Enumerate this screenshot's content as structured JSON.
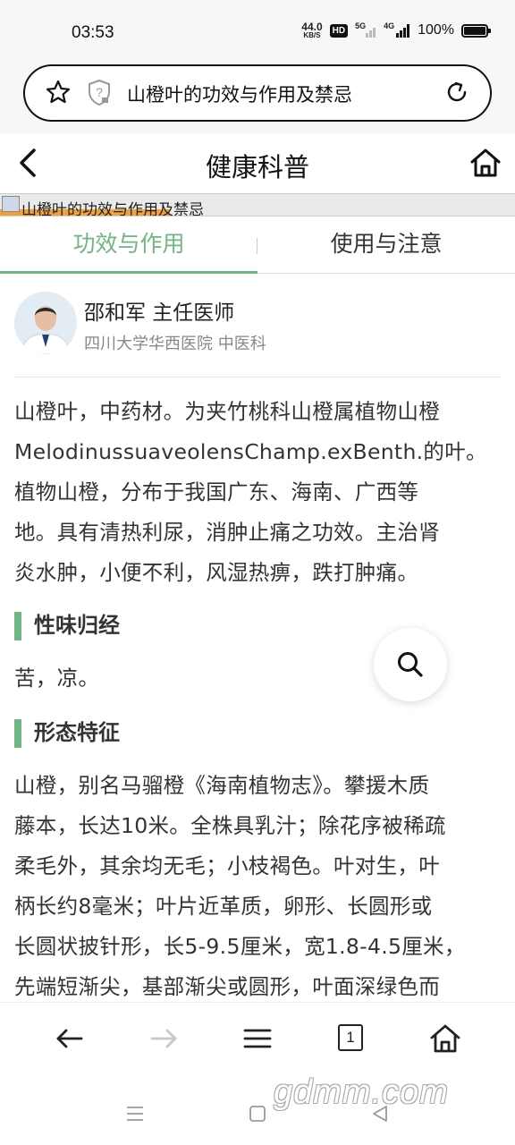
{
  "status_bar": {
    "time": "03:53",
    "net_speed_value": "44.0",
    "net_speed_unit": "KB/S",
    "hd_badge": "HD",
    "signal1_label": "5G",
    "signal2_label": "4G",
    "battery": "100%"
  },
  "url_bar": {
    "text": "山橙叶的功效与作用及禁忌",
    "icons": [
      "star-icon",
      "shield-icon",
      "reload-icon"
    ]
  },
  "header": {
    "title": "健康科普",
    "icons": [
      "back-arrow-icon",
      "home-icon"
    ]
  },
  "banner": {
    "alt_text": "山橙叶的功效与作用及禁忌"
  },
  "tabs": [
    {
      "label": "功效与作用",
      "active": true
    },
    {
      "label": "使用与注意",
      "active": false
    }
  ],
  "doctor": {
    "name_title": "邵和军 主任医师",
    "hospital_dept": "四川大学华西医院 中医科"
  },
  "article": {
    "intro_lines": [
      "山橙叶，中药材。为夹竹桃科山橙属植物山橙",
      "MelodinussuaveolensChamp.exBenth.的叶。",
      "植物山橙，分布于我国广东、海南、广西等",
      "地。具有清热利尿，消肿止痛之功效。主治肾",
      "炎水肿，小便不利，风湿热痹，跌打肿痛。"
    ],
    "section1_title": "性味归经",
    "section1_text": "苦，凉。",
    "section2_title": "形态特征",
    "section2_lines": [
      "山橙，别名马骝橙《海南植物志》。攀援木质",
      "藤本，长达10米。全株具乳汁；除花序被稀疏",
      "柔毛外，其余均无毛；小枝褐色。叶对生，叶",
      "柄长约8毫米；叶片近革质，卵形、长圆形或",
      "长圆状披针形，长5-9.5厘米，宽1.8-4.5厘米，",
      "先端短渐尖，基部渐尖或圆形，叶面深绿色而"
    ]
  },
  "floating_button": {
    "icon": "search-icon"
  },
  "toolbar": {
    "tab_count": "1",
    "icons": [
      "back-icon",
      "forward-icon",
      "menu-icon",
      "tabs-icon",
      "home-icon"
    ]
  },
  "system_nav": {
    "icons": [
      "recents-icon",
      "home-square-icon",
      "back-triangle-icon"
    ],
    "watermark": "gdmm.com"
  },
  "colors": {
    "accent": "#6fb683",
    "text": "#333333",
    "muted": "#888888",
    "chrome_bg": "#f7f7f7"
  }
}
